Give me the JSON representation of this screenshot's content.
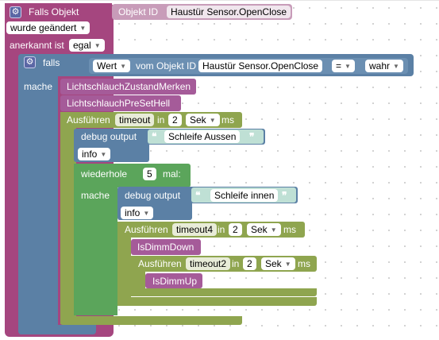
{
  "trigger": {
    "title": "Falls Objekt",
    "object_id_label": "Objekt ID",
    "object_id_value": "Haustür Sensor.OpenClose",
    "event_value": "wurde geändert",
    "ack_label": "anerkannt ist",
    "ack_value": "egal"
  },
  "if_block": {
    "label": "falls",
    "do_label": "mache",
    "value_dropdown": "Wert",
    "from_object_label": "vom Objekt ID",
    "object_id_value": "Haustür Sensor.OpenClose",
    "operator": "=",
    "compare_value": "wahr"
  },
  "calls": {
    "call1": "LichtschlauchZustandMerken",
    "call2": "LichtschlauchPreSetHell",
    "call3": "IsDimmDown",
    "call4": "IsDimmUp"
  },
  "timeout1": {
    "label": "Ausführen",
    "name": "timeout",
    "in_label": "in",
    "value": "2",
    "unit": "Sek",
    "suffix": "ms"
  },
  "debug1": {
    "label": "debug output",
    "text": "Schleife Aussen",
    "level": "info"
  },
  "repeat": {
    "label": "wiederhole",
    "count": "5",
    "times_label": "mal:",
    "do_label": "mache"
  },
  "debug2": {
    "label": "debug output",
    "text": "Schleife innen",
    "level": "info"
  },
  "timeout4": {
    "label": "Ausführen",
    "name": "timeout4",
    "in_label": "in",
    "value": "2",
    "unit": "Sek",
    "suffix": "ms"
  },
  "timeout2": {
    "label": "Ausführen",
    "name": "timeout2",
    "in_label": "in",
    "value": "2",
    "unit": "Sek",
    "suffix": "ms"
  },
  "colors": {
    "trigger": "#a5467f",
    "if": "#5b80a5",
    "function": "#a55b99",
    "timeout": "#8fa54f",
    "debug": "#5b80a5",
    "loop": "#5ba55b",
    "text": "#bfe0d5"
  }
}
